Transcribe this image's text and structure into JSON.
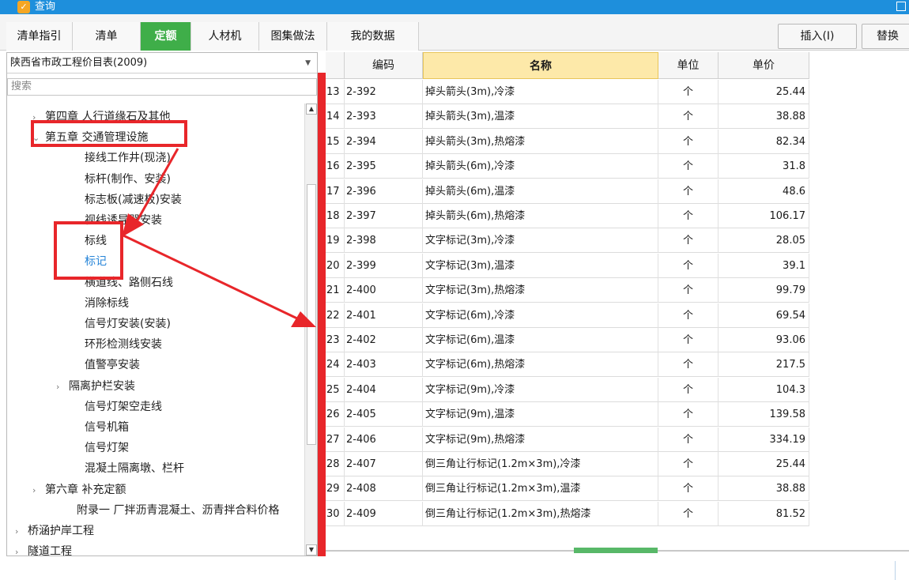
{
  "window": {
    "title": "查询"
  },
  "tabs": [
    {
      "label": "清单指引",
      "active": false
    },
    {
      "label": "清单",
      "active": false
    },
    {
      "label": "定额",
      "active": true
    },
    {
      "label": "人材机",
      "active": false
    },
    {
      "label": "图集做法",
      "active": false
    },
    {
      "label": "我的数据",
      "active": false
    }
  ],
  "toolbar": {
    "insert_label": "插入(I)",
    "replace_label": "替换"
  },
  "catalog": {
    "selected": "陕西省市政工程价目表(2009)"
  },
  "search": {
    "placeholder": "搜索"
  },
  "tree": [
    {
      "label": "第四章 人行道缘石及其他",
      "arrow": "›"
    },
    {
      "label": "第五章 交通管理设施",
      "arrow": "⌄"
    },
    {
      "label": "接线工作井(现浇)",
      "arrow": ""
    },
    {
      "label": "标杆(制作、安装)",
      "arrow": ""
    },
    {
      "label": "标志板(减速板)安装",
      "arrow": ""
    },
    {
      "label": "视线诱导器安装",
      "arrow": ""
    },
    {
      "label": "标线",
      "arrow": ""
    },
    {
      "label": "标记",
      "arrow": ""
    },
    {
      "label": "横道线、路侧石线",
      "arrow": ""
    },
    {
      "label": "消除标线",
      "arrow": ""
    },
    {
      "label": "信号灯安装(安装)",
      "arrow": ""
    },
    {
      "label": "环形检测线安装",
      "arrow": ""
    },
    {
      "label": "值警亭安装",
      "arrow": ""
    },
    {
      "label": "隔离护栏安装",
      "arrow": "›"
    },
    {
      "label": "信号灯架空走线",
      "arrow": ""
    },
    {
      "label": "信号机箱",
      "arrow": ""
    },
    {
      "label": "信号灯架",
      "arrow": ""
    },
    {
      "label": "混凝土隔离墩、栏杆",
      "arrow": ""
    },
    {
      "label": "第六章 补充定额",
      "arrow": "›"
    },
    {
      "label": "附录一 厂拌沥青混凝土、沥青拌合料价格",
      "arrow": ""
    },
    {
      "label": "桥涵护岸工程",
      "arrow": "›"
    },
    {
      "label": "隧道工程",
      "arrow": "›"
    }
  ],
  "grid": {
    "headers": {
      "code": "编码",
      "name": "名称",
      "unit": "单位",
      "price": "单价"
    },
    "rows": [
      {
        "num": "13",
        "code": "2-392",
        "name": "掉头箭头(3m),冷漆",
        "unit": "个",
        "price": "25.44"
      },
      {
        "num": "14",
        "code": "2-393",
        "name": "掉头箭头(3m),温漆",
        "unit": "个",
        "price": "38.88"
      },
      {
        "num": "15",
        "code": "2-394",
        "name": "掉头箭头(3m),热熔漆",
        "unit": "个",
        "price": "82.34"
      },
      {
        "num": "16",
        "code": "2-395",
        "name": "掉头箭头(6m),冷漆",
        "unit": "个",
        "price": "31.8"
      },
      {
        "num": "17",
        "code": "2-396",
        "name": "掉头箭头(6m),温漆",
        "unit": "个",
        "price": "48.6"
      },
      {
        "num": "18",
        "code": "2-397",
        "name": "掉头箭头(6m),热熔漆",
        "unit": "个",
        "price": "106.17"
      },
      {
        "num": "19",
        "code": "2-398",
        "name": "文字标记(3m),冷漆",
        "unit": "个",
        "price": "28.05"
      },
      {
        "num": "20",
        "code": "2-399",
        "name": "文字标记(3m),温漆",
        "unit": "个",
        "price": "39.1"
      },
      {
        "num": "21",
        "code": "2-400",
        "name": "文字标记(3m),热熔漆",
        "unit": "个",
        "price": "99.79"
      },
      {
        "num": "22",
        "code": "2-401",
        "name": "文字标记(6m),冷漆",
        "unit": "个",
        "price": "69.54"
      },
      {
        "num": "23",
        "code": "2-402",
        "name": "文字标记(6m),温漆",
        "unit": "个",
        "price": "93.06"
      },
      {
        "num": "24",
        "code": "2-403",
        "name": "文字标记(6m),热熔漆",
        "unit": "个",
        "price": "217.5"
      },
      {
        "num": "25",
        "code": "2-404",
        "name": "文字标记(9m),冷漆",
        "unit": "个",
        "price": "104.3"
      },
      {
        "num": "26",
        "code": "2-405",
        "name": "文字标记(9m),温漆",
        "unit": "个",
        "price": "139.58"
      },
      {
        "num": "27",
        "code": "2-406",
        "name": "文字标记(9m),热熔漆",
        "unit": "个",
        "price": "334.19"
      },
      {
        "num": "28",
        "code": "2-407",
        "name": "倒三角让行标记(1.2m×3m),冷漆",
        "unit": "个",
        "price": "25.44"
      },
      {
        "num": "29",
        "code": "2-408",
        "name": "倒三角让行标记(1.2m×3m),温漆",
        "unit": "个",
        "price": "38.88"
      },
      {
        "num": "30",
        "code": "2-409",
        "name": "倒三角让行标记(1.2m×3m),热熔漆",
        "unit": "个",
        "price": "81.52"
      }
    ]
  },
  "colors": {
    "accent_green": "#3fae49",
    "title_blue": "#1e8fdc",
    "annotation_red": "#e8262a",
    "selected_text": "#2684d8"
  }
}
